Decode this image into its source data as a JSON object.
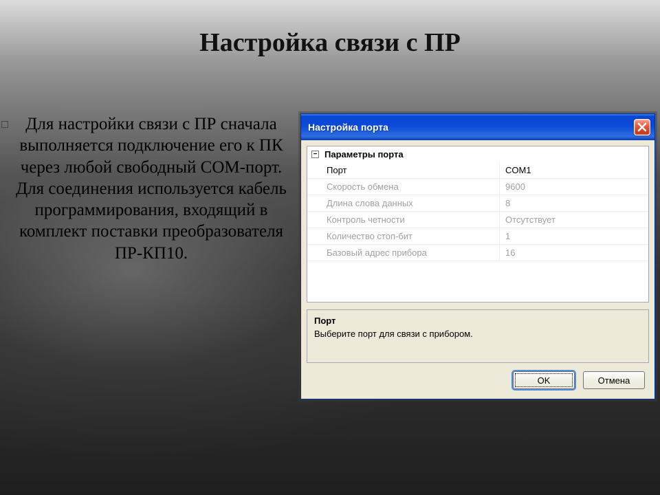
{
  "slide": {
    "title": "Настройка связи с ПР",
    "body": "Для настройки связи с ПР сначала выполняется подключение его к ПК через любой свободный COM-порт. Для соединения используется кабель программирования, входящий в комплект поставки преобразователя ПР-КП10."
  },
  "dialog": {
    "title": "Настройка порта",
    "close_icon": "close-icon",
    "group_label": "Параметры порта",
    "properties": [
      {
        "name": "Порт",
        "value": "COM1",
        "enabled": true
      },
      {
        "name": "Скорость обмена",
        "value": "9600",
        "enabled": false
      },
      {
        "name": "Длина слова данных",
        "value": "8",
        "enabled": false
      },
      {
        "name": "Контроль четности",
        "value": "Отсутствует",
        "enabled": false
      },
      {
        "name": "Количество стоп-бит",
        "value": "1",
        "enabled": false
      },
      {
        "name": "Базовый адрес прибора",
        "value": "16",
        "enabled": false
      }
    ],
    "hint": {
      "title": "Порт",
      "text": "Выберите порт для связи с прибором."
    },
    "buttons": {
      "ok": "OK",
      "cancel": "Отмена"
    }
  }
}
